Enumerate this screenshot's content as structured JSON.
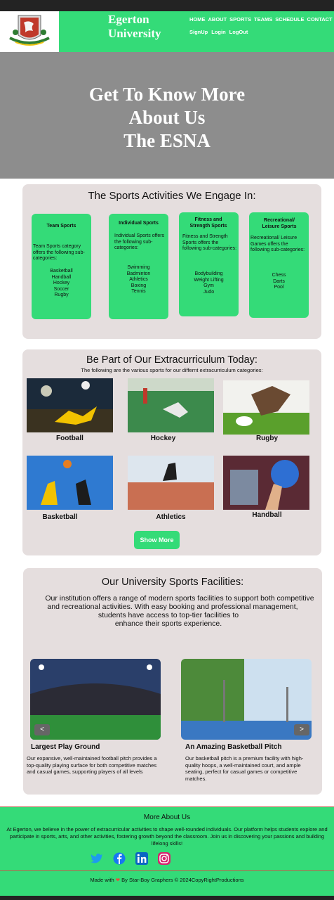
{
  "header": {
    "brand": [
      "Egerton",
      "University"
    ],
    "nav_primary": [
      "HOME",
      "ABOUT",
      "SPORTS",
      "TEAMS",
      "SCHEDULE",
      "CONTACT"
    ],
    "nav_secondary": [
      "SignUp",
      "Login",
      "LogOut"
    ]
  },
  "hero": {
    "title_lines": [
      "Get To Know More",
      "About Us",
      "The ESNA"
    ]
  },
  "activities": {
    "title": "The  Sports  Activities  We  Engage In:",
    "cards": [
      {
        "title": "Team Sports",
        "desc": "Team Sports category offers the following sub-categories:",
        "items": [
          "Basketball",
          "Handball",
          "Hockey",
          "Soccer",
          "Rugby"
        ]
      },
      {
        "title": "Individual Sports",
        "desc": "Individual Sports offers the following sub-categories:",
        "items": [
          "Swimming",
          "Badminton",
          "Athletics",
          "Boxing",
          "Tennis"
        ]
      },
      {
        "title": "Fitness and Strength Sports",
        "desc": "Fitness and Strength Sports offers the following sub-categories:",
        "items": [
          "Bodybuilding",
          "Weight Lifting",
          "Gym",
          "Judo"
        ]
      },
      {
        "title": "Recreational/ Leisure Sports",
        "desc": "Recreational/ Leisure Games offers the following sub-categories:",
        "items": [
          "Chess",
          "Darts",
          "Pool"
        ]
      }
    ]
  },
  "extracurricular": {
    "title": "Be Part of Our Extracurriculum Today:",
    "subtitle": "The  following are the various sports for our differnt extracurriculum  categories:",
    "sports": [
      "Football",
      "Hockey",
      "Rugby",
      "Basketball",
      "Athletics",
      "Handball"
    ],
    "show_more": "Show More"
  },
  "facilities": {
    "title": "Our University Sports Facilities:",
    "intro_lines": [
      "Our institution offers a range of modern sports facilities to support both competitive",
      "and recreational activities. With easy booking and professional management,",
      "students have access to top-tier facilities to",
      "enhance their sports experience."
    ],
    "items": [
      {
        "title": "Largest Play Ground",
        "desc": "Our expansive, well-maintained football pitch provides a top-quality playing surface for both competitive matches and casual games, supporting players of all levels"
      },
      {
        "title": "An Amazing Basketball Pitch",
        "desc": "Our basketball pitch is a premium facility with high-quality hoops, a well-maintained court, and ample seating, perfect for casual games or competitive matches."
      }
    ],
    "prev_arrow": "<",
    "next_arrow": ">"
  },
  "footer": {
    "title": "More About Us",
    "text": "At Egerton, we believe in the power of extracurricular activities to shape well-rounded individuals. Our platform helps students explore and participate in sports, arts, and other activities, fostering growth beyond the classroom. Join us in discovering your passions and building lifelong skills!",
    "socials": [
      "twitter-icon",
      "facebook-icon",
      "linkedin-icon",
      "instagram-icon"
    ],
    "credit_before": "Made with",
    "credit_after": "By Star-Boy Graphers  © 2024CopyRightProductions"
  },
  "colors": {
    "accent": "#34db78",
    "hero": "#8d8d8d",
    "card": "#e5dede",
    "dark": "#232323"
  }
}
